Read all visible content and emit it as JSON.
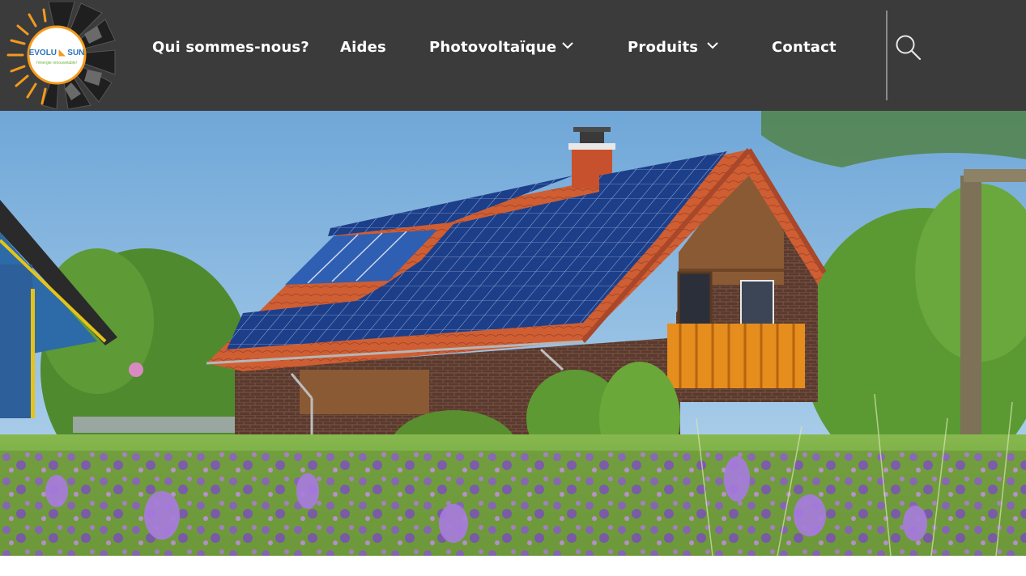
{
  "brand": {
    "logo_word_left": "EVOLU",
    "logo_word_right": "SUN",
    "tagline": "l'énergie renouvelable!"
  },
  "nav": {
    "items": [
      {
        "label": "Qui sommes-nous?",
        "has_dropdown": false
      },
      {
        "label": "Aides",
        "has_dropdown": false
      },
      {
        "label": "Photovoltaïque",
        "has_dropdown": true
      },
      {
        "label": "Produits",
        "has_dropdown": true
      },
      {
        "label": "Contact",
        "has_dropdown": false
      }
    ]
  },
  "search": {
    "icon": "search-icon"
  },
  "colors": {
    "header_bg": "#3b3b3b",
    "nav_text": "#ffffff",
    "logo_orange": "#f39a1c",
    "logo_blue": "#2a74b8",
    "logo_green": "#6db33f"
  },
  "hero": {
    "image": "house-with-solar-panels-and-wildflowers"
  }
}
